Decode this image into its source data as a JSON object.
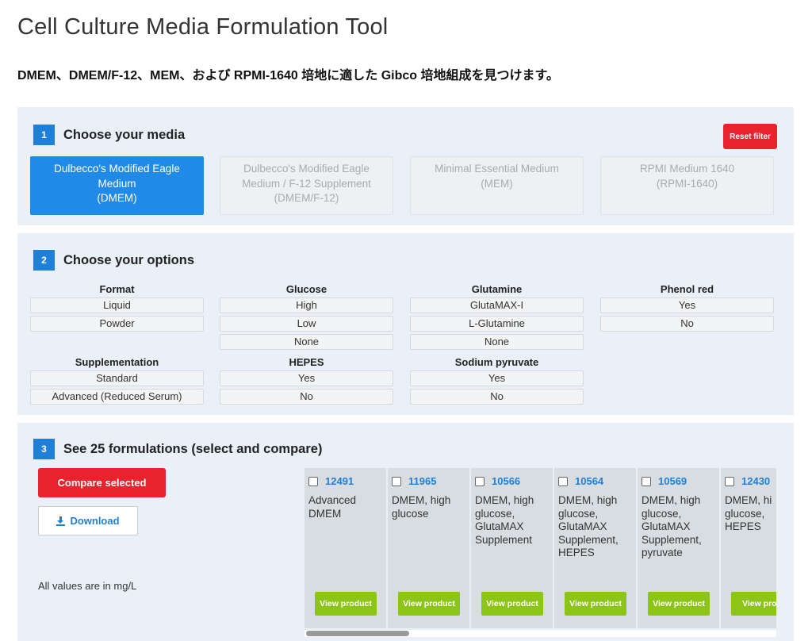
{
  "page": {
    "title": "Cell Culture Media Formulation Tool",
    "subtitle": "DMEM、DMEM/F-12、MEM、および RPMI-1640 培地に適した Gibco 培地組成を見つけます。"
  },
  "step1": {
    "number": "1",
    "title": "Choose your media",
    "reset_label": "Reset filter",
    "media": [
      {
        "line1": "Dulbecco's Modified Eagle",
        "line2": "Medium",
        "line3": "(DMEM)",
        "active": true
      },
      {
        "line1": "Dulbecco's Modified Eagle",
        "line2": "Medium / F-12 Supplement",
        "line3": "(DMEM/F-12)",
        "active": false
      },
      {
        "line1": "Minimal Essential Medium",
        "line2": "(MEM)",
        "line3": "",
        "active": false
      },
      {
        "line1": "RPMI Medium 1640",
        "line2": "(RPMI-1640)",
        "line3": "",
        "active": false
      }
    ]
  },
  "step2": {
    "number": "2",
    "title": "Choose your options",
    "groups": {
      "format": {
        "label": "Format",
        "options": [
          "Liquid",
          "Powder"
        ]
      },
      "glucose": {
        "label": "Glucose",
        "options": [
          "High",
          "Low",
          "None"
        ]
      },
      "glutamine": {
        "label": "Glutamine",
        "options": [
          "GlutaMAX-I",
          "L-Glutamine",
          "None"
        ]
      },
      "phenol_red": {
        "label": "Phenol red",
        "options": [
          "Yes",
          "No"
        ]
      },
      "supplementation": {
        "label": "Supplementation",
        "options": [
          "Standard",
          "Advanced (Reduced Serum)"
        ]
      },
      "hepes": {
        "label": "HEPES",
        "options": [
          "Yes",
          "No"
        ]
      },
      "sodium_pyruvate": {
        "label": "Sodium pyruvate",
        "options": [
          "Yes",
          "No"
        ]
      }
    }
  },
  "step3": {
    "number": "3",
    "title": "See 25 formulations (select and compare)",
    "compare_label": "Compare selected",
    "download_label": "Download",
    "units_note": "All values are in mg/L",
    "view_label": "View product",
    "view_label_partial": "View prod",
    "formulations": [
      {
        "number": "12491",
        "description": "Advanced DMEM"
      },
      {
        "number": "11965",
        "description": "DMEM, high glucose"
      },
      {
        "number": "10566",
        "description": "DMEM, high glucose, GlutaMAX Supplement"
      },
      {
        "number": "10564",
        "description": "DMEM, high glucose, GlutaMAX Supplement, HEPES"
      },
      {
        "number": "10569",
        "description": "DMEM, high glucose, GlutaMAX Supplement, pyruvate"
      },
      {
        "number": "12430",
        "description": "DMEM, hi glucose, HEPES"
      }
    ]
  }
}
